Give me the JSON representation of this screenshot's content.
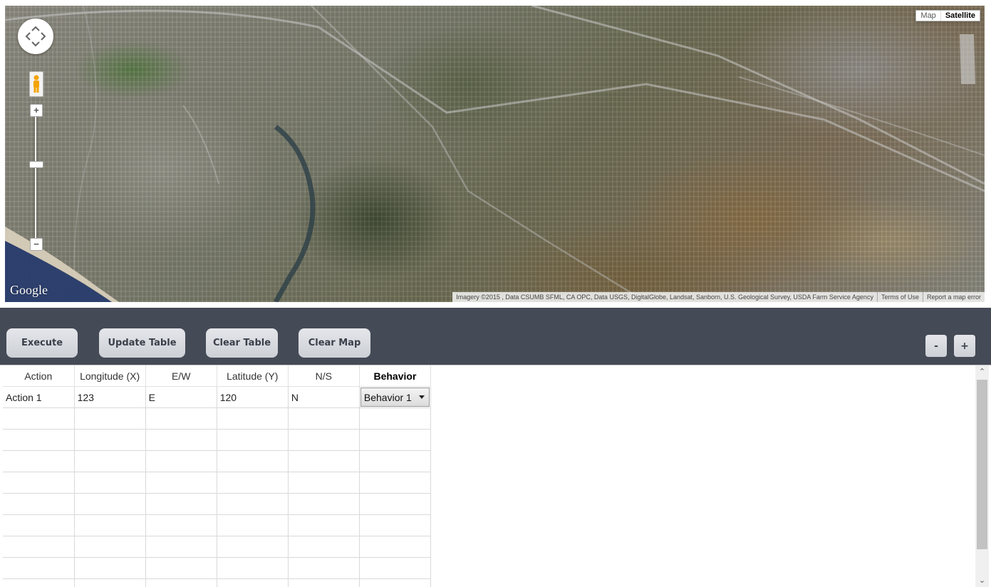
{
  "map": {
    "type_options": [
      "Map",
      "Satellite"
    ],
    "active_type": "Satellite",
    "logo": "Google",
    "attribution": "Imagery ©2015 , Data CSUMB SFML, CA OPC, Data USGS, DigitalGlobe, Landsat, Sanborn, U.S. Geological Survey, USDA Farm Service Agency",
    "terms_link": "Terms of Use",
    "report_link": "Report a map error",
    "zoom_in": "+",
    "zoom_out": "−"
  },
  "toolbar": {
    "execute_label": "Execute",
    "update_label": "Update Table",
    "clear_table_label": "Clear Table",
    "clear_map_label": "Clear Map",
    "minus_label": "-",
    "plus_label": "+"
  },
  "table": {
    "headers": [
      "Action",
      "Longitude (X)",
      "E/W",
      "Latitude (Y)",
      "N/S",
      "Behavior"
    ],
    "rows": [
      {
        "action": "Action 1",
        "longitude": "123",
        "ew": "E",
        "latitude": "120",
        "ns": "N",
        "behavior": "Behavior 1"
      }
    ],
    "empty_rows": 9
  },
  "icons": {
    "pan": "pan-control-icon",
    "pegman": "street-view-pegman-icon",
    "caret": "dropdown-caret-icon",
    "scroll_up": "scroll-up-arrow-icon",
    "scroll_down": "scroll-down-arrow-icon"
  },
  "colors": {
    "toolbar_bg": "#444a56",
    "button_bg": "#d6d9de",
    "button_text": "#3a3f4a"
  }
}
